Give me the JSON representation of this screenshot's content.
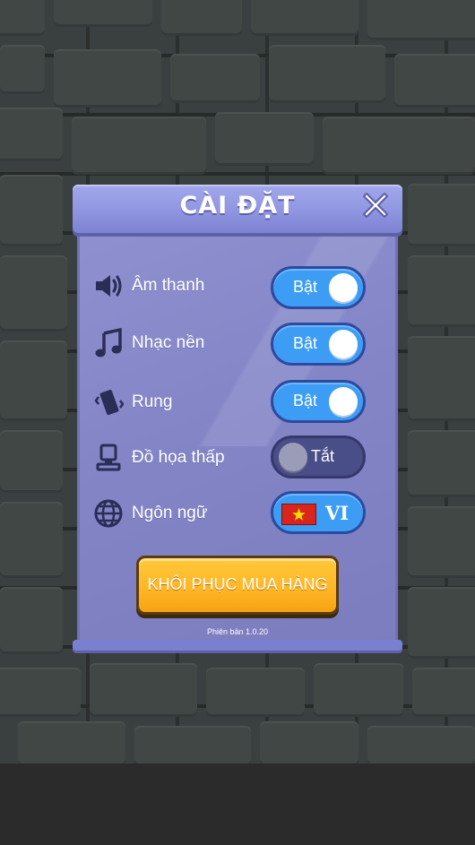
{
  "dialog": {
    "title": "CÀI ĐẶT",
    "close_icon": "close-icon"
  },
  "settings": [
    {
      "id": "sound",
      "icon": "speaker-icon",
      "label": "Âm thanh",
      "state": "on",
      "value": "Bật"
    },
    {
      "id": "music",
      "icon": "music-note-icon",
      "label": "Nhạc nền",
      "state": "on",
      "value": "Bật"
    },
    {
      "id": "vibrate",
      "icon": "vibrate-phone-icon",
      "label": "Rung",
      "state": "on",
      "value": "Bật"
    },
    {
      "id": "low-graphics",
      "icon": "low-graphics-icon",
      "label": "Đồ họa thấp",
      "state": "off",
      "value": "Tắt"
    }
  ],
  "language": {
    "icon": "globe-icon",
    "label": "Ngôn ngữ",
    "flag": "vietnam-flag-icon",
    "code": "VI"
  },
  "restore_button": "KHÔI PHỤC MUA HÀNG",
  "version": "Phiên bản 1.0.20",
  "colors": {
    "toggle_on": "#3d9df5",
    "toggle_off": "#4a4e88",
    "panel": "#8385c7",
    "button": "#ffb525"
  }
}
